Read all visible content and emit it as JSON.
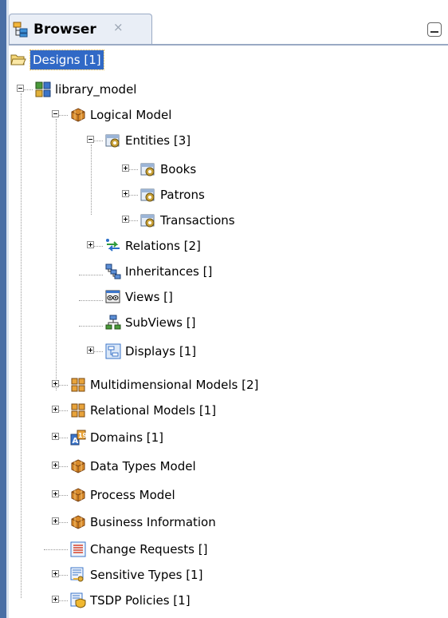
{
  "panel": {
    "tab_title": "Browser",
    "tab_close": "×"
  },
  "tree": {
    "designs": "Designs [1]",
    "library_model": "library_model",
    "logical_model": "Logical Model",
    "entities": "Entities [3]",
    "books": "Books",
    "patrons": "Patrons",
    "transactions": "Transactions",
    "relations": "Relations [2]",
    "inheritances": "Inheritances []",
    "views": "Views []",
    "subviews": "SubViews []",
    "displays": "Displays [1]",
    "multidimensional_models": "Multidimensional Models [2]",
    "relational_models": "Relational Models [1]",
    "domains": "Domains [1]",
    "data_types_model": "Data Types Model",
    "process_model": "Process Model",
    "business_information": "Business Information",
    "change_requests": "Change Requests []",
    "sensitive_types": "Sensitive Types [1]",
    "tsdp_policies": "TSDP Policies [1]"
  },
  "colors": {
    "selection": "#3169c6",
    "panel_accent": "#4a6fa5"
  }
}
